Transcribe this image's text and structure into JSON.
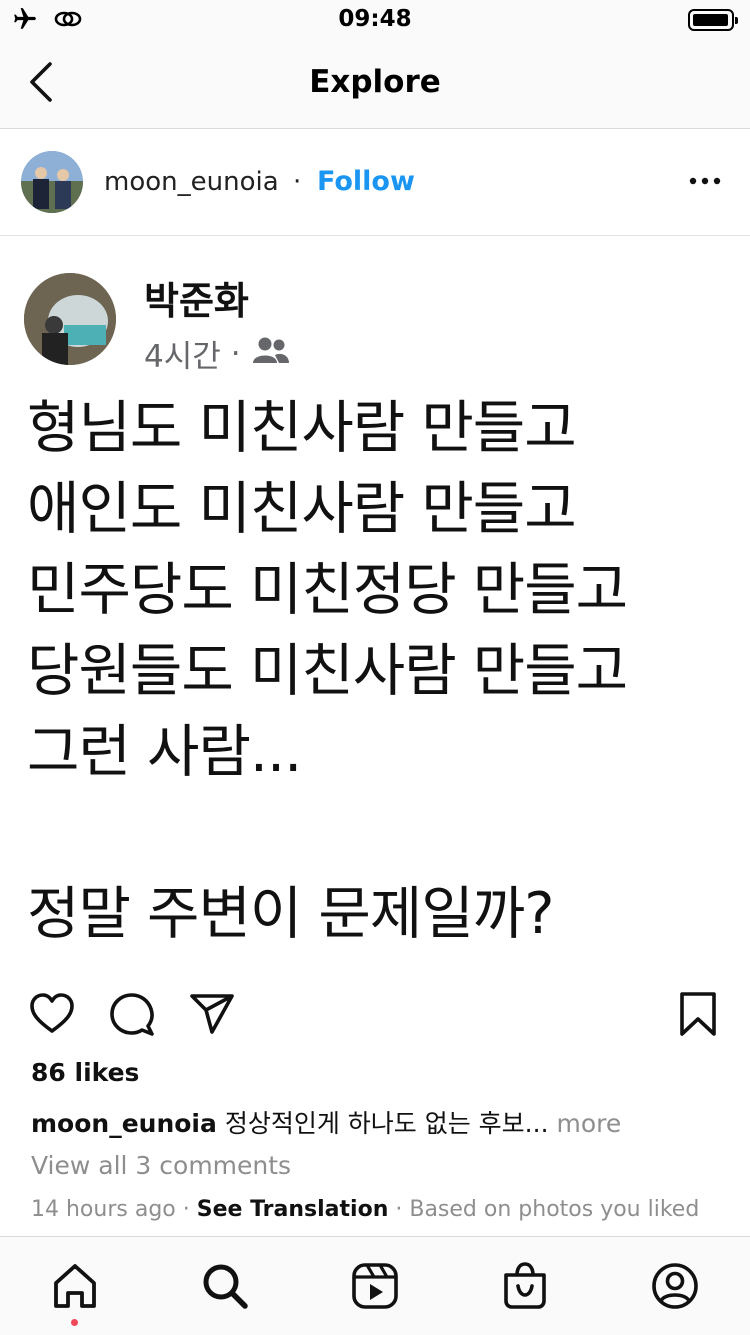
{
  "status_bar": {
    "time": "09:48",
    "icons": [
      "airplane-icon",
      "link-icon",
      "battery-icon"
    ]
  },
  "nav": {
    "title": "Explore",
    "back_icon": "chevron-left-icon"
  },
  "post_header": {
    "username": "moon_eunoia",
    "separator": "·",
    "follow_label": "Follow",
    "follow_color": "#1a95f1",
    "more_icon": "more-horizontal-icon"
  },
  "post_image": {
    "author_name": "박준화",
    "time_ago": "4시간",
    "meta_separator": "·",
    "audience_icon": "friends-icon",
    "text": "형님도 미친사람 만들고\n애인도 미친사람 만들고\n민주당도 미친정당 만들고\n당원들도 미친사람 만들고\n그런 사람...\n\n정말 주변이 문제일까?"
  },
  "actions": {
    "icons": [
      "heart-icon",
      "comment-icon",
      "share-icon",
      "bookmark-icon"
    ]
  },
  "likes": "86 likes",
  "caption": {
    "username": "moon_eunoia",
    "text": "정상적인게 하나도 없는 후보...",
    "more_label": "more"
  },
  "view_comments": "View all 3 comments",
  "meta": {
    "time_ago": "14 hours ago",
    "separator": "·",
    "see_translation": "See Translation",
    "based_on": "Based on photos you liked"
  },
  "tab_bar": {
    "tabs": [
      "home-icon",
      "search-icon",
      "reels-icon",
      "shop-icon",
      "profile-icon"
    ],
    "notification_color": "#ed4956"
  }
}
